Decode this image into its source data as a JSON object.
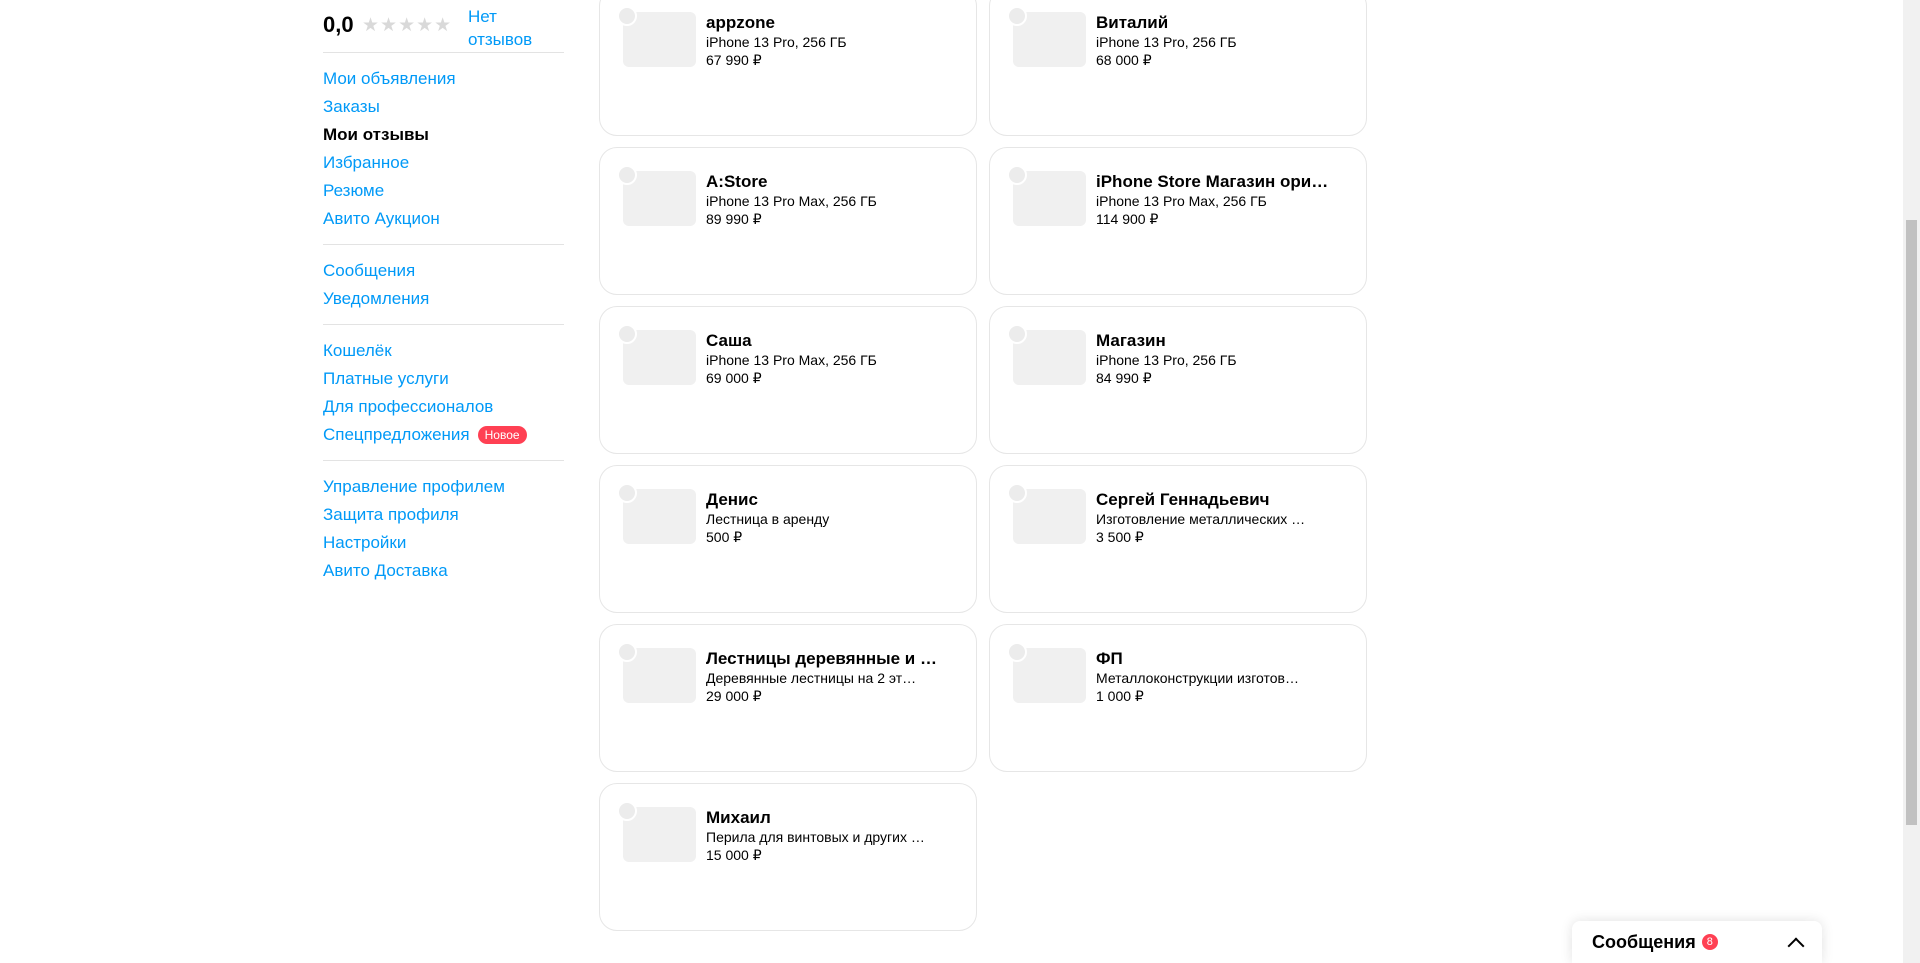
{
  "rating": {
    "value": "0,0",
    "stars": "★★★★★",
    "filled_stars": 0,
    "no_reviews": "Нет отзывов"
  },
  "sidebar": {
    "groups": [
      [
        "Мои объявления",
        "Заказы",
        "Мои отзывы",
        "Избранное",
        "Резюме",
        "Авито Аукцион"
      ],
      [
        "Сообщения",
        "Уведомления"
      ],
      [
        "Кошелёк",
        "Платные услуги",
        "Для профессионалов",
        "Спецпредложения"
      ],
      [
        "Управление профилем",
        "Защита профиля",
        "Настройки",
        "Авито Доставка"
      ]
    ],
    "active": "Мои отзывы",
    "new_badge": "Новое"
  },
  "cards": [
    {
      "name": "appzone",
      "desc": "iPhone 13 Pro, 256 ГБ",
      "price": "67 990 ₽"
    },
    {
      "name": "Виталий",
      "desc": "iPhone 13 Pro, 256 ГБ",
      "price": "68 000 ₽"
    },
    {
      "name": "A:Store",
      "desc": "iPhone 13 Pro Max, 256 ГБ",
      "price": "89 990 ₽"
    },
    {
      "name": "iPhone Store Магазин ори…",
      "desc": "iPhone 13 Pro Max, 256 ГБ",
      "price": "114 900 ₽"
    },
    {
      "name": "Саша",
      "desc": "iPhone 13 Pro Max, 256 ГБ",
      "price": "69 000 ₽"
    },
    {
      "name": "Магазин",
      "desc": "iPhone 13 Pro, 256 ГБ",
      "price": "84 990 ₽"
    },
    {
      "name": "Денис",
      "desc": "Лестница в аренду",
      "price": "500 ₽"
    },
    {
      "name": "Сергей Геннадьевич",
      "desc": "Изготовление металлических …",
      "price": "3 500 ₽"
    },
    {
      "name": "Лестницы деревянные и …",
      "desc": "Деревянные лестницы на 2 эт…",
      "price": "29 000 ₽"
    },
    {
      "name": "ФП",
      "desc": "Металлоконструкции изготов…",
      "price": "1 000 ₽"
    },
    {
      "name": "Михаил",
      "desc": "Перила для винтовых и других …",
      "price": "15 000 ₽"
    }
  ],
  "messenger": {
    "title": "Сообщения",
    "count": "8"
  },
  "colors": {
    "link": "#0099f7",
    "badge": "#ff4053",
    "card_border": "#e6e6e6"
  }
}
